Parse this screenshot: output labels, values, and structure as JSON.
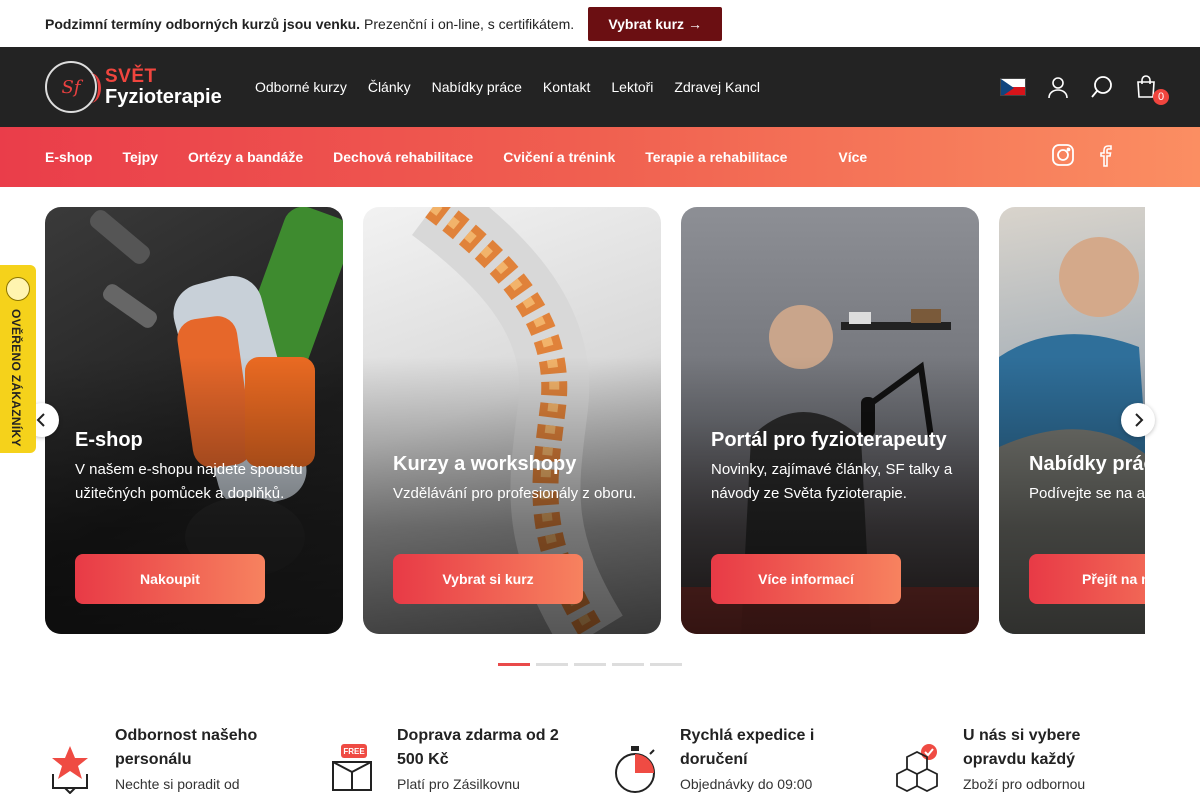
{
  "announcement": {
    "bold": "Podzimní termíny odborných kurzů jsou venku.",
    "text": "Prezenční i on-line, s certifikátem.",
    "cta": "Vybrat kurz →"
  },
  "logo": {
    "line1": "SVĚT",
    "line2": "Fyzioterapie",
    "monogram": "Sf"
  },
  "main_nav": [
    "Odborné kurzy",
    "Články",
    "Nabídky práce",
    "Kontakt",
    "Lektoři",
    "Zdravej Kancl"
  ],
  "header_icons": {
    "flag": "czech-flag-icon",
    "user": "user-icon",
    "search": "search-icon",
    "cart": "cart-icon",
    "cart_count": "0"
  },
  "categories": [
    "E-shop",
    "Tejpy",
    "Ortézy a bandáže",
    "Dechová rehabilitace",
    "Cvičení a trénink",
    "Terapie a rehabilitace"
  ],
  "categories_more": "Více",
  "social": [
    "instagram-icon",
    "facebook-icon"
  ],
  "cards": [
    {
      "title": "E-shop",
      "text": "V našem e-shopu najdete spoustu užitečných pomůcek a doplňků.",
      "button": "Nakoupit"
    },
    {
      "title": "Kurzy a workshopy",
      "text": "Vzdělávání pro profesionály z oboru.",
      "button": "Vybrat si kurz"
    },
    {
      "title": "Portál pro fyzioterapeuty",
      "text": "Novinky, zajímavé články, SF talky  a návody ze Světa fyzioterapie.",
      "button": "Více informací"
    },
    {
      "title": "Nabídky prác",
      "text": "Podívejte se na a práce v oboru fy.",
      "button": "Přejít na nab"
    }
  ],
  "carousel_dots": {
    "count": 5,
    "active": 1
  },
  "side_badge": "OVĚŘENO ZÁKAZNÍKY",
  "features": [
    {
      "icon": "star-badge-icon",
      "title": "Odbornost našeho personálu",
      "subtitle": "Nechte si poradit  od"
    },
    {
      "icon": "free-shipping-box-icon",
      "title": "Doprava zdarma od 2 500 Kč",
      "subtitle": "Platí pro Zásilkovnu",
      "badge": "FREE"
    },
    {
      "icon": "stopwatch-icon",
      "title": "Rychlá expedice i doručení",
      "subtitle": "Objednávky do 09:00"
    },
    {
      "icon": "boxes-check-icon",
      "title": "U nás si vybere opravdu každý",
      "subtitle": "Zboží pro odbornou"
    }
  ]
}
